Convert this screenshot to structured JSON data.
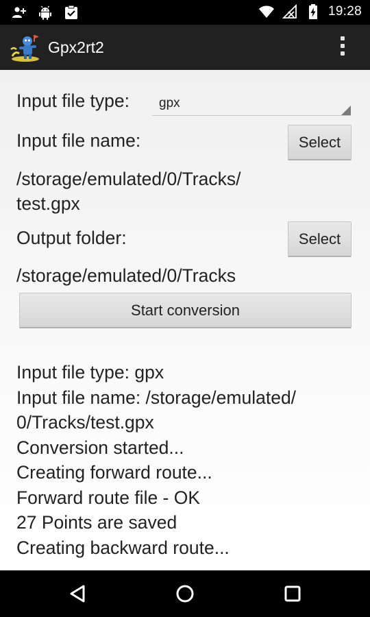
{
  "status_bar": {
    "time": "19:28",
    "left_icons": [
      "add-person-icon",
      "android-icon",
      "clipboard-check-icon"
    ],
    "right_icons": [
      "wifi-icon",
      "no-signal-icon",
      "battery-charging-icon"
    ]
  },
  "app_bar": {
    "title": "Gpx2rt2",
    "logo_icon": "app-logo-icon",
    "menu_icon": "overflow-menu-icon"
  },
  "form": {
    "input_type_label": "Input file type:",
    "input_type_value": "gpx",
    "input_name_label": "Input file name:",
    "input_select_button": "Select",
    "input_path_line1": "/storage/emulated/0/Tracks/",
    "input_path_line2": "test.gpx",
    "output_folder_label": "Output folder:",
    "output_select_button": "Select",
    "output_path": "/storage/emulated/0/Tracks",
    "start_button": "Start conversion"
  },
  "log": {
    "lines": [
      "Input file type: gpx",
      "Input file name: /storage/emulated/",
      "0/Tracks/test.gpx",
      "Conversion started...",
      "Creating forward route...",
      "Forward route file - OK",
      "27 Points are saved",
      "Creating backward route..."
    ]
  },
  "nav_bar": {
    "back_icon": "back-icon",
    "home_icon": "home-icon",
    "recents_icon": "recents-icon"
  },
  "colors": {
    "action_bar": "#212121",
    "content_bg": "#f5f5f5",
    "button_bg": "#dcdcdc",
    "text": "#222222"
  }
}
